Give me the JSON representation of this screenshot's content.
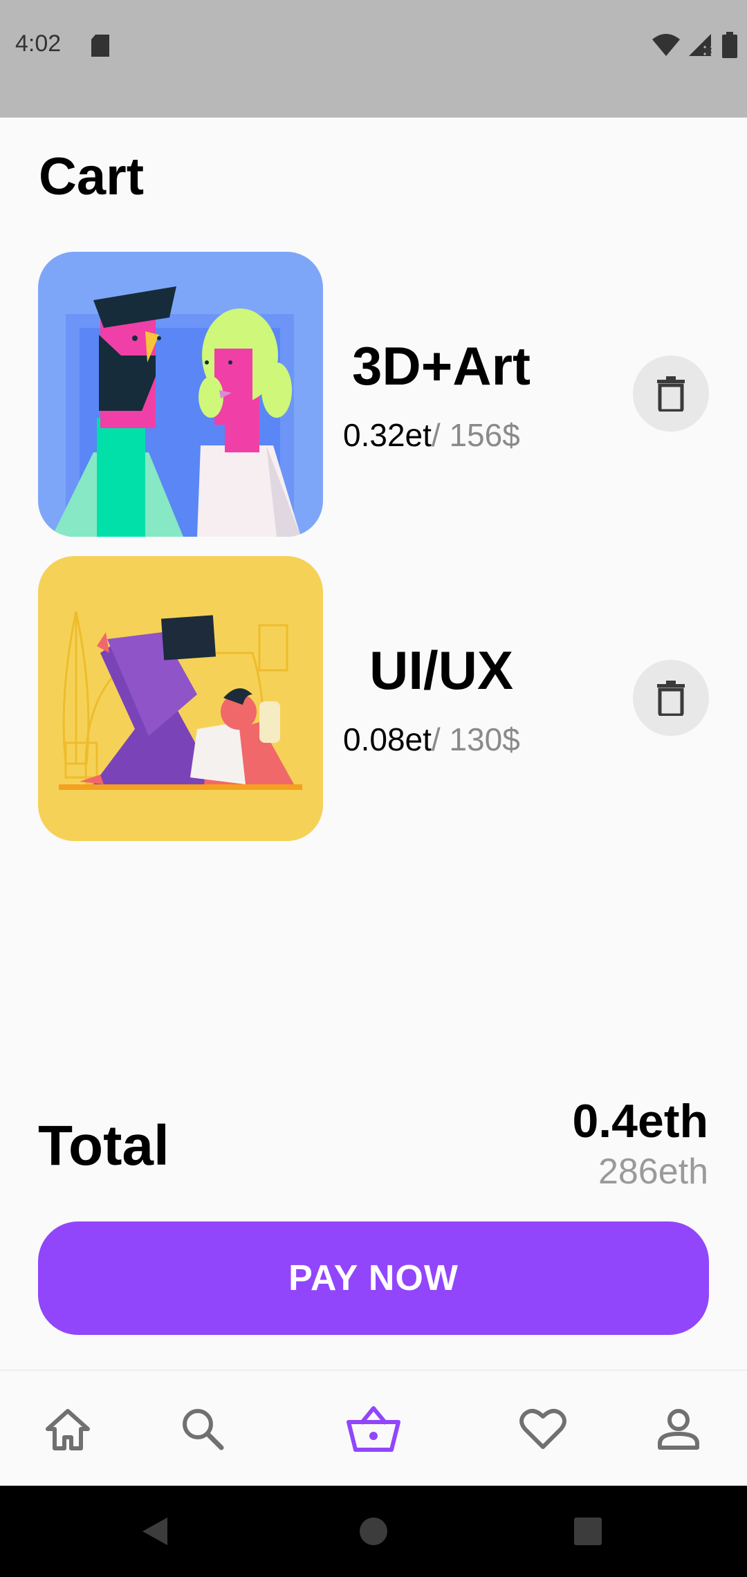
{
  "status_bar": {
    "time": "4:02"
  },
  "page": {
    "title": "Cart"
  },
  "cart": {
    "items": [
      {
        "title": "3D+Art",
        "price_eth": "0.32et",
        "price_usd": "/ 156$",
        "thumbnail": "couple-illustration"
      },
      {
        "title": "UI/UX",
        "price_eth": "0.08et",
        "price_usd": "/ 130$",
        "thumbnail": "lounging-person-illustration"
      }
    ]
  },
  "summary": {
    "total_label": "Total",
    "total_eth": "0.4eth",
    "total_sub": "286eth"
  },
  "actions": {
    "pay_label": "PAY NOW"
  },
  "bottom_nav": {
    "items": [
      {
        "icon": "home-icon",
        "active": false
      },
      {
        "icon": "search-icon",
        "active": false
      },
      {
        "icon": "basket-icon",
        "active": true
      },
      {
        "icon": "heart-icon",
        "active": false
      },
      {
        "icon": "person-icon",
        "active": false
      }
    ]
  },
  "colors": {
    "accent": "#9146fb",
    "thumb1_bg": "#7ea6f8",
    "thumb2_bg": "#f5d257",
    "status_bar": "#b8b8b8"
  }
}
